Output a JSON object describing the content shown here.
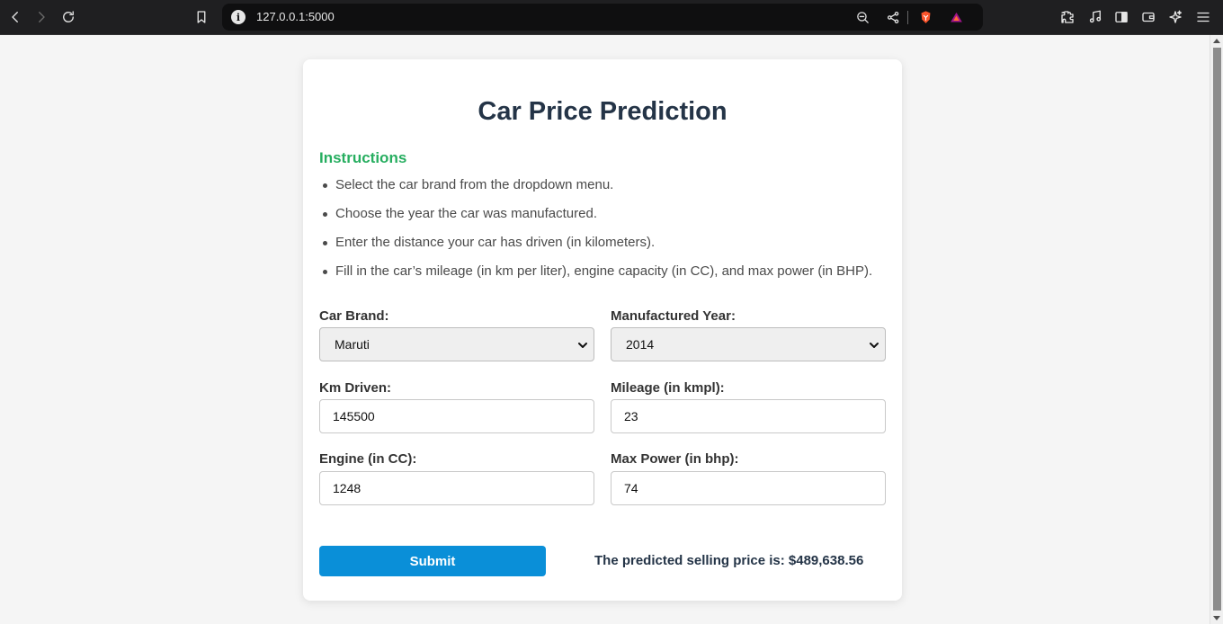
{
  "browser": {
    "url": "127.0.0.1:5000"
  },
  "page": {
    "title": "Car Price Prediction",
    "instructions_heading": "Instructions",
    "instructions": [
      "Select the car brand from the dropdown menu.",
      "Choose the year the car was manufactured.",
      "Enter the distance your car has driven (in kilometers).",
      "Fill in the car’s mileage (in km per liter), engine capacity (in CC), and max power (in BHP)."
    ],
    "form": {
      "brand": {
        "label": "Car Brand:",
        "value": "Maruti"
      },
      "year": {
        "label": "Manufactured Year:",
        "value": "2014"
      },
      "km": {
        "label": "Km Driven:",
        "value": "145500"
      },
      "mileage": {
        "label": "Mileage (in kmpl):",
        "value": "23"
      },
      "engine": {
        "label": "Engine (in CC):",
        "value": "1248"
      },
      "power": {
        "label": "Max Power (in bhp):",
        "value": "74"
      }
    },
    "submit_label": "Submit",
    "result": "The predicted selling price is: $489,638.56"
  },
  "colors": {
    "accent": "#0a8fd8",
    "heading_green": "#27ae60",
    "title": "#243447"
  }
}
